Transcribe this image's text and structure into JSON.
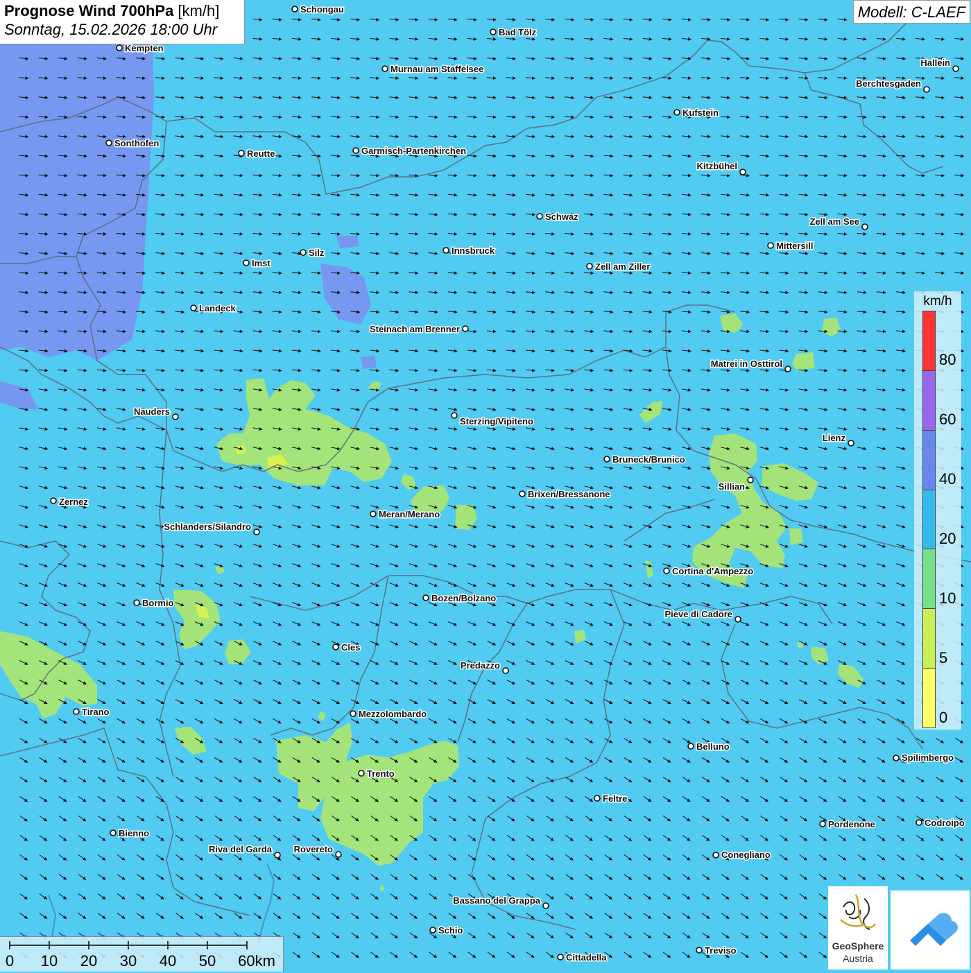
{
  "header": {
    "title": "Prognose Wind 700hPa",
    "unit": "[km/h]",
    "datetime": "Sonntag, 15.02.2026 18:00 Uhr",
    "model": "Modell: C-LAEF"
  },
  "legend": {
    "unit": "km/h",
    "ticks": [
      "80",
      "60",
      "40",
      "20",
      "10",
      "5",
      "0"
    ],
    "colors": [
      "#ff3333",
      "#9966ee",
      "#6688ee",
      "#33bbee",
      "#77e088",
      "#c8f055",
      "#ffff66"
    ]
  },
  "scale": {
    "labels": [
      "0",
      "10",
      "20",
      "30",
      "40",
      "50",
      "60km"
    ]
  },
  "logo": {
    "name": "GeoSphere",
    "sub": "Austria"
  },
  "colors": {
    "background": "#52cbf2",
    "wind_10_20": "#9ee36c",
    "wind_5_10": "#c8f055",
    "wind_20_40": "#7d8ff0"
  },
  "cities": [
    {
      "name": "Schongau"
    },
    {
      "name": "Bad Tölz"
    },
    {
      "name": "Kempten"
    },
    {
      "name": "Murnau am Staffelsee"
    },
    {
      "name": "Hallein"
    },
    {
      "name": "Berchtesgaden"
    },
    {
      "name": "Kufstein"
    },
    {
      "name": "Sonthofen"
    },
    {
      "name": "Reutte"
    },
    {
      "name": "Garmisch-Partenkirchen"
    },
    {
      "name": "Kitzbühel"
    },
    {
      "name": "Schwaz"
    },
    {
      "name": "Zell am See"
    },
    {
      "name": "Mittersill"
    },
    {
      "name": "Innsbruck"
    },
    {
      "name": "Silz"
    },
    {
      "name": "Imst"
    },
    {
      "name": "Zell am Ziller"
    },
    {
      "name": "Landeck"
    },
    {
      "name": "Steinach am Brenner"
    },
    {
      "name": "Matrei in Osttirol"
    },
    {
      "name": "Nauders"
    },
    {
      "name": "Sterzing/Vipiteno"
    },
    {
      "name": "Lienz"
    },
    {
      "name": "Bruneck/Brunico"
    },
    {
      "name": "Sillian"
    },
    {
      "name": "Zernez"
    },
    {
      "name": "Brixen/Bressanone"
    },
    {
      "name": "Meran/Merano"
    },
    {
      "name": "Schlanders/Silandro"
    },
    {
      "name": "Cortina d'Ampezzo"
    },
    {
      "name": "Bozen/Bolzano"
    },
    {
      "name": "Bormio"
    },
    {
      "name": "Pieve di Cadore"
    },
    {
      "name": "Cles"
    },
    {
      "name": "Predazzo"
    },
    {
      "name": "Tirano"
    },
    {
      "name": "Mezzolombardo"
    },
    {
      "name": "Belluno"
    },
    {
      "name": "Spilimbergo"
    },
    {
      "name": "Trento"
    },
    {
      "name": "Feltre"
    },
    {
      "name": "Bienno"
    },
    {
      "name": "Pordenone"
    },
    {
      "name": "Codroipo"
    },
    {
      "name": "Riva del Garda"
    },
    {
      "name": "Rovereto"
    },
    {
      "name": "Conegliano"
    },
    {
      "name": "Bassano del Grappa"
    },
    {
      "name": "Schio"
    },
    {
      "name": "Treviso"
    },
    {
      "name": "Cittadella"
    }
  ]
}
